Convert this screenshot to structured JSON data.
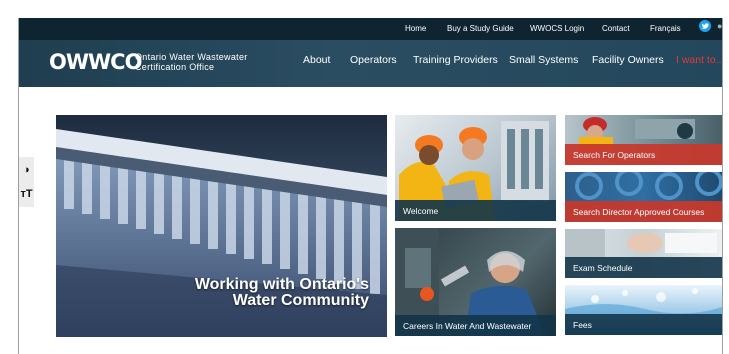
{
  "header": {
    "utility_links": [
      "Home",
      "Buy a Study Guide",
      "WWOCS Login",
      "Contact",
      "Français"
    ],
    "logo_letters": "OWWCO",
    "logo_line1": "Ontario Water Wastewater",
    "logo_line2": "Certification Office",
    "nav": [
      "About",
      "Operators",
      "Training Providers",
      "Small Systems",
      "Facility Owners",
      "I want to..."
    ]
  },
  "tools": {
    "contrast_icon": "◑",
    "text_size_icon": "тT"
  },
  "hero": {
    "title_line1": "Working with Ontario's",
    "title_line2": "Water Community"
  },
  "tiles": {
    "welcome": "Welcome",
    "careers": "Careers In Water And Wastewater",
    "search_operators": "Search For Operators",
    "search_courses": "Search Director Approved Courses",
    "exam_schedule": "Exam Schedule",
    "fees": "Fees"
  },
  "colors": {
    "header_bg": "#17313f",
    "caption_navy": "#123448",
    "caption_red": "#c6392d",
    "nav_accent": "#e23b3b"
  }
}
